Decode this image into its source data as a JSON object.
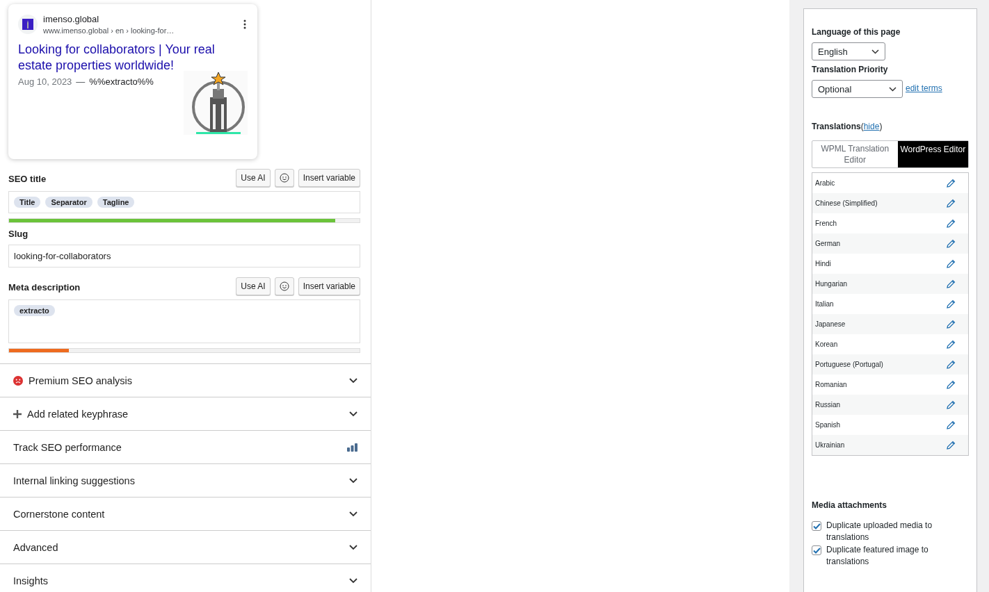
{
  "preview": {
    "site_name": "imenso.global",
    "url": "www.imenso.global › en › looking-for…",
    "title": "Looking for collaborators | Your real estate properties worldwide!",
    "date": "Aug 10, 2023",
    "separator": "—",
    "description": "%%extracto%%"
  },
  "seo_title": {
    "label": "SEO title",
    "buttons": [
      "Use AI",
      "Insert variable"
    ],
    "tags": [
      "Title",
      "Separator",
      "Tagline"
    ],
    "meter": {
      "level": 0.93,
      "color": "#6bc33a"
    }
  },
  "slug": {
    "label": "Slug",
    "value": "looking-for-collaborators"
  },
  "meta_description": {
    "label": "Meta description",
    "buttons": [
      "Use AI",
      "Insert variable"
    ],
    "tags": [
      "extracto"
    ],
    "meter": {
      "level": 0.17,
      "color": "#ee6b1f"
    }
  },
  "sections": [
    {
      "label": "Premium SEO analysis",
      "kind": "analysis"
    },
    {
      "label": "Add related keyphrase",
      "kind": "add"
    },
    {
      "label": "Track SEO performance",
      "kind": "track"
    },
    {
      "label": "Internal linking suggestions",
      "kind": "section"
    },
    {
      "label": "Cornerstone content",
      "kind": "section"
    },
    {
      "label": "Advanced",
      "kind": "section"
    },
    {
      "label": "Insights",
      "kind": "section"
    }
  ],
  "language_panel": {
    "language_label": "Language of this page",
    "language_value": "English",
    "priority_label": "Translation Priority",
    "priority_value": "Optional",
    "edit_terms": "edit terms",
    "translations_label": "Translations",
    "open_paren": "(",
    "hide_link": "hide",
    "close_paren": ")",
    "editor_tabs": [
      {
        "label": "WPML Translation Editor",
        "selected": false
      },
      {
        "label": "WordPress Editor",
        "selected": true
      }
    ],
    "languages": [
      "Arabic",
      "Chinese (Simplified)",
      "French",
      "German",
      "Hindi",
      "Hungarian",
      "Italian",
      "Japanese",
      "Korean",
      "Portuguese (Portugal)",
      "Romanian",
      "Russian",
      "Spanish",
      "Ukrainian"
    ],
    "media_label": "Media attachments",
    "media_options": [
      {
        "label": "Duplicate uploaded media to translations",
        "checked": true
      },
      {
        "label": "Duplicate featured image to translations",
        "checked": true
      }
    ]
  }
}
